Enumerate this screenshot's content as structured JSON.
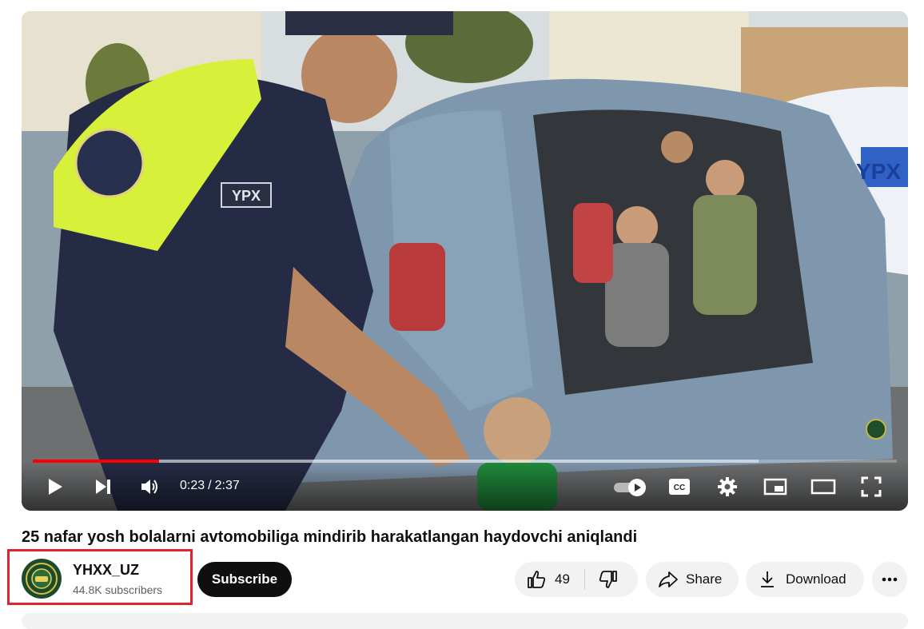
{
  "player": {
    "current_time": "0:23",
    "time_separator": "/",
    "duration": "2:37",
    "progress_fraction": 0.146,
    "buffered_fraction": 0.84,
    "autoplay_on": true,
    "scene": {
      "uniform_patch_text": "YPX",
      "door_text": "YPX"
    }
  },
  "video": {
    "title": "25 nafar yosh bolalarni avtomobiliga mindirib harakatlangan haydovchi aniqlandi"
  },
  "channel": {
    "name": "YHXX_UZ",
    "subscribers": "44.8K subscribers",
    "subscribe_label": "Subscribe"
  },
  "actions": {
    "like_count": "49",
    "share_label": "Share",
    "download_label": "Download"
  },
  "colors": {
    "progress": "#ff0000",
    "highlight_box": "#e0232e",
    "subscribe_bg": "#0f0f0f",
    "pill_bg": "#f2f2f2"
  },
  "icons": [
    "play-icon",
    "next-icon",
    "volume-icon",
    "autoplay-toggle-icon",
    "captions-icon",
    "settings-gear-icon",
    "miniplayer-icon",
    "theater-mode-icon",
    "fullscreen-icon",
    "thumbs-up-icon",
    "thumbs-down-icon",
    "share-arrow-icon",
    "download-icon",
    "more-dots-icon"
  ]
}
